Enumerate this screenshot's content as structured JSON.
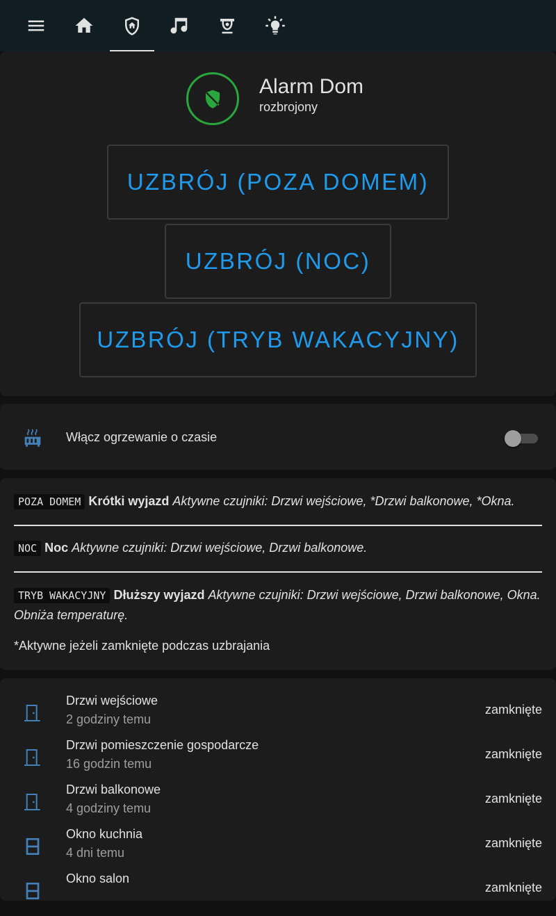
{
  "toolbar": {
    "menu_icon": "menu-icon",
    "tabs": [
      {
        "icon": "home-icon"
      },
      {
        "icon": "shield-home-icon",
        "active": true
      },
      {
        "icon": "music-icon"
      },
      {
        "icon": "cctv-icon"
      },
      {
        "icon": "lightbulb-icon"
      }
    ]
  },
  "alarm": {
    "title": "Alarm Dom",
    "state": "rozbrojony",
    "icon": "shield-off-icon",
    "status_color": "#2aa63e",
    "buttons": [
      {
        "label": "UZBRÓJ (POZA DOMEM)"
      },
      {
        "label": "UZBRÓJ (NOC)"
      },
      {
        "label": "UZBRÓJ (TRYB WAKACYJNY)"
      }
    ]
  },
  "heating": {
    "label": "Włącz ogrzewanie o czasie",
    "icon": "radiator-icon",
    "on": false
  },
  "modes": [
    {
      "code": "POZA DOMEM",
      "name": "Krótki wyjazd",
      "desc": "Aktywne czujniki: Drzwi wejściowe, *Drzwi balkonowe, *Okna."
    },
    {
      "code": "NOC",
      "name": "Noc",
      "desc": "Aktywne czujniki: Drzwi wejściowe, Drzwi balkonowe."
    },
    {
      "code": "TRYB WAKACYJNY",
      "name": "Dłuższy wyjazd",
      "desc": "Aktywne czujniki: Drzwi wejściowe, Drzwi balkonowe, Okna. Obniża temperaturę."
    }
  ],
  "modes_note": "*Aktywne jeżeli zamknięte podczas uzbrajania",
  "sensors": [
    {
      "name": "Drzwi wejściowe",
      "time": "2 godziny temu",
      "state": "zamknięte",
      "icon": "door-closed-icon"
    },
    {
      "name": "Drzwi pomieszczenie gospodarcze",
      "time": "16 godzin temu",
      "state": "zamknięte",
      "icon": "door-closed-icon"
    },
    {
      "name": "Drzwi balkonowe",
      "time": "4 godziny temu",
      "state": "zamknięte",
      "icon": "door-closed-icon"
    },
    {
      "name": "Okno kuchnia",
      "time": "4 dni temu",
      "state": "zamknięte",
      "icon": "window-closed-icon"
    },
    {
      "name": "Okno salon",
      "time": "",
      "state": "zamknięte",
      "icon": "window-closed-icon"
    }
  ],
  "colors": {
    "accent": "#1e9bed",
    "icon": "#4481b8",
    "header": "#101e24",
    "card": "#1c1c1c"
  }
}
